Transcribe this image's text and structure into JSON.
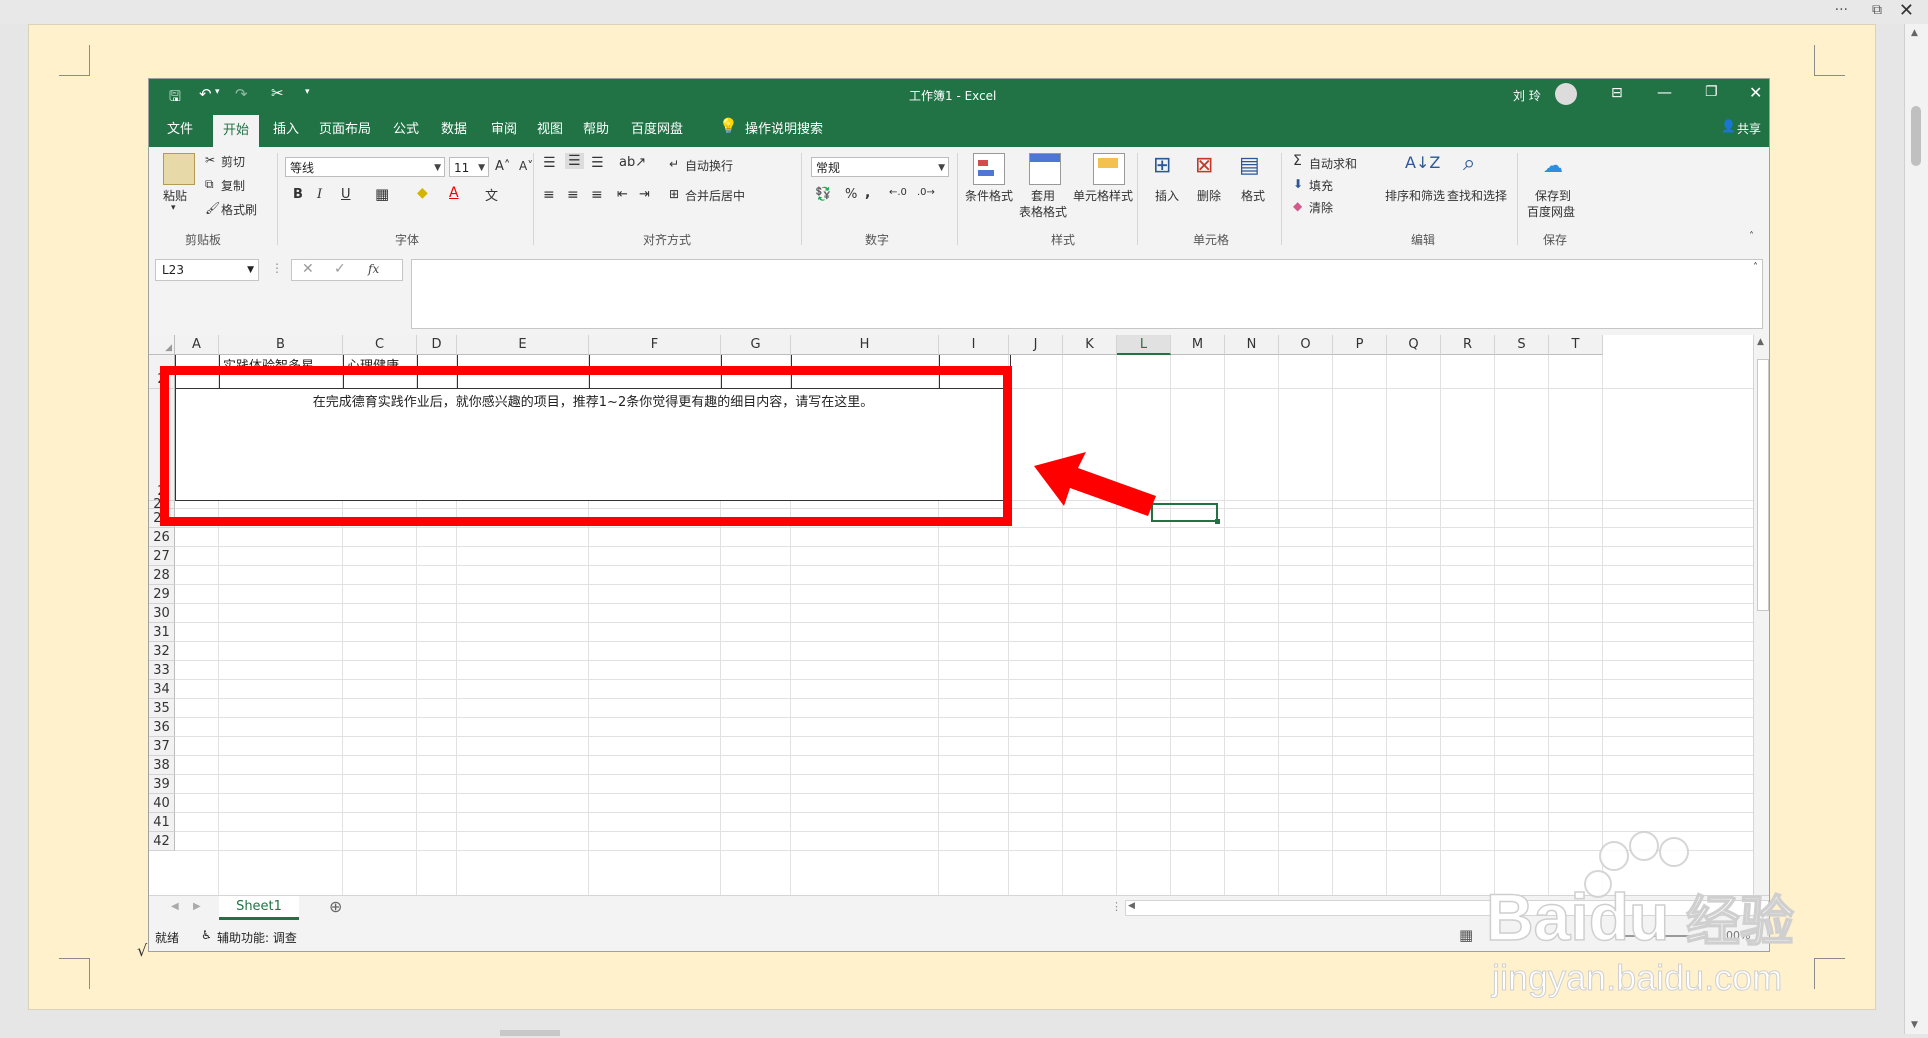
{
  "window": {
    "title": "工作簿1 - Excel",
    "user": "刘 玲"
  },
  "menu": {
    "tabs": [
      "文件",
      "开始",
      "插入",
      "页面布局",
      "公式",
      "数据",
      "审阅",
      "视图",
      "帮助",
      "百度网盘"
    ],
    "tell_me": "操作说明搜索",
    "share": "共享"
  },
  "ribbon": {
    "clipboard": {
      "paste": "粘贴",
      "cut": "剪切",
      "copy": "复制",
      "format_painter": "格式刷",
      "group": "剪贴板"
    },
    "font": {
      "name": "等线",
      "size": "11",
      "bold": "B",
      "italic": "I",
      "underline": "U",
      "group": "字体"
    },
    "alignment": {
      "wrap": "自动换行",
      "merge": "合并后居中",
      "group": "对齐方式"
    },
    "number": {
      "format": "常规",
      "percent": "%",
      "comma": ",",
      "group": "数字"
    },
    "styles": {
      "conditional": "条件格式",
      "table_line1": "套用",
      "table_line2": "表格格式",
      "cell_styles": "单元格样式",
      "group": "样式"
    },
    "cells": {
      "insert": "插入",
      "delete": "删除",
      "format": "格式",
      "group": "单元格"
    },
    "editing": {
      "autosum": "自动求和",
      "fill": "填充",
      "clear": "清除",
      "sort": "排序和筛选",
      "find": "查找和选择",
      "group": "编辑"
    },
    "save": {
      "line1": "保存到",
      "line2": "百度网盘",
      "group": "保存"
    }
  },
  "formula_bar": {
    "name_box": "L23",
    "fx": "fx",
    "value": ""
  },
  "grid": {
    "columns": [
      "A",
      "B",
      "C",
      "D",
      "E",
      "F",
      "G",
      "H",
      "I",
      "J",
      "K",
      "L",
      "M",
      "N",
      "O",
      "P",
      "Q",
      "R",
      "S",
      "T"
    ],
    "selected_column": "L",
    "rows": [
      "2",
      "2",
      "24",
      "25",
      "26",
      "27",
      "28",
      "29",
      "30",
      "31",
      "32",
      "33",
      "34",
      "35",
      "36",
      "37",
      "38",
      "39",
      "40",
      "41",
      "42"
    ],
    "cell_b": "实践体验智多星",
    "cell_c": "心理健康",
    "merged_text": "在完成德育实践作业后，就你感兴趣的项目，推荐1~2条你觉得更有趣的细目内容，请写在这里。"
  },
  "sheets": {
    "active": "Sheet1"
  },
  "status": {
    "ready": "就绪",
    "accessibility": "辅助功能: 调查",
    "zoom": "100%"
  },
  "colors": {
    "excel_green": "#217346",
    "highlight_red": "#ff0000",
    "page_background": "#fff1cc"
  },
  "watermark": {
    "brand": "Baidu",
    "brand_cn": "经验",
    "url": "jingyan.baidu.com"
  }
}
